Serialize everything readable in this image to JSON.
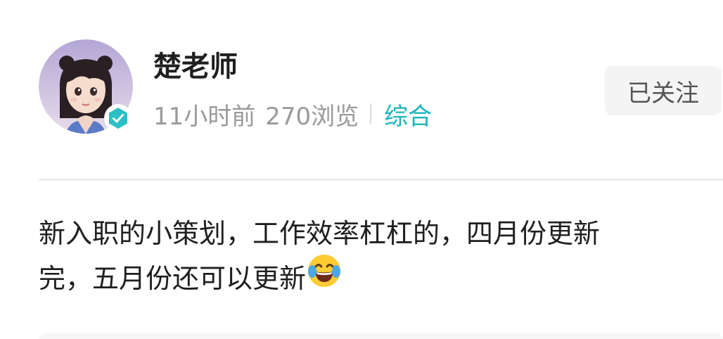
{
  "post": {
    "author": {
      "name": "楚老师",
      "avatar_icon": "avatar-girl-icon",
      "verified_icon": "verified-badge-icon"
    },
    "time": "11小时前",
    "views": "270浏览",
    "category": "综合",
    "follow_label": "已关注",
    "content_line1": "新入职的小策划，工作效率杠杠的，四月份更新",
    "content_line2": "完，五月份还可以更新",
    "emoji": "laughing-tears-emoji-icon"
  },
  "colors": {
    "accent": "#1ab5b8",
    "muted_text": "#9a9a9a",
    "button_bg": "#f4f4f4"
  }
}
